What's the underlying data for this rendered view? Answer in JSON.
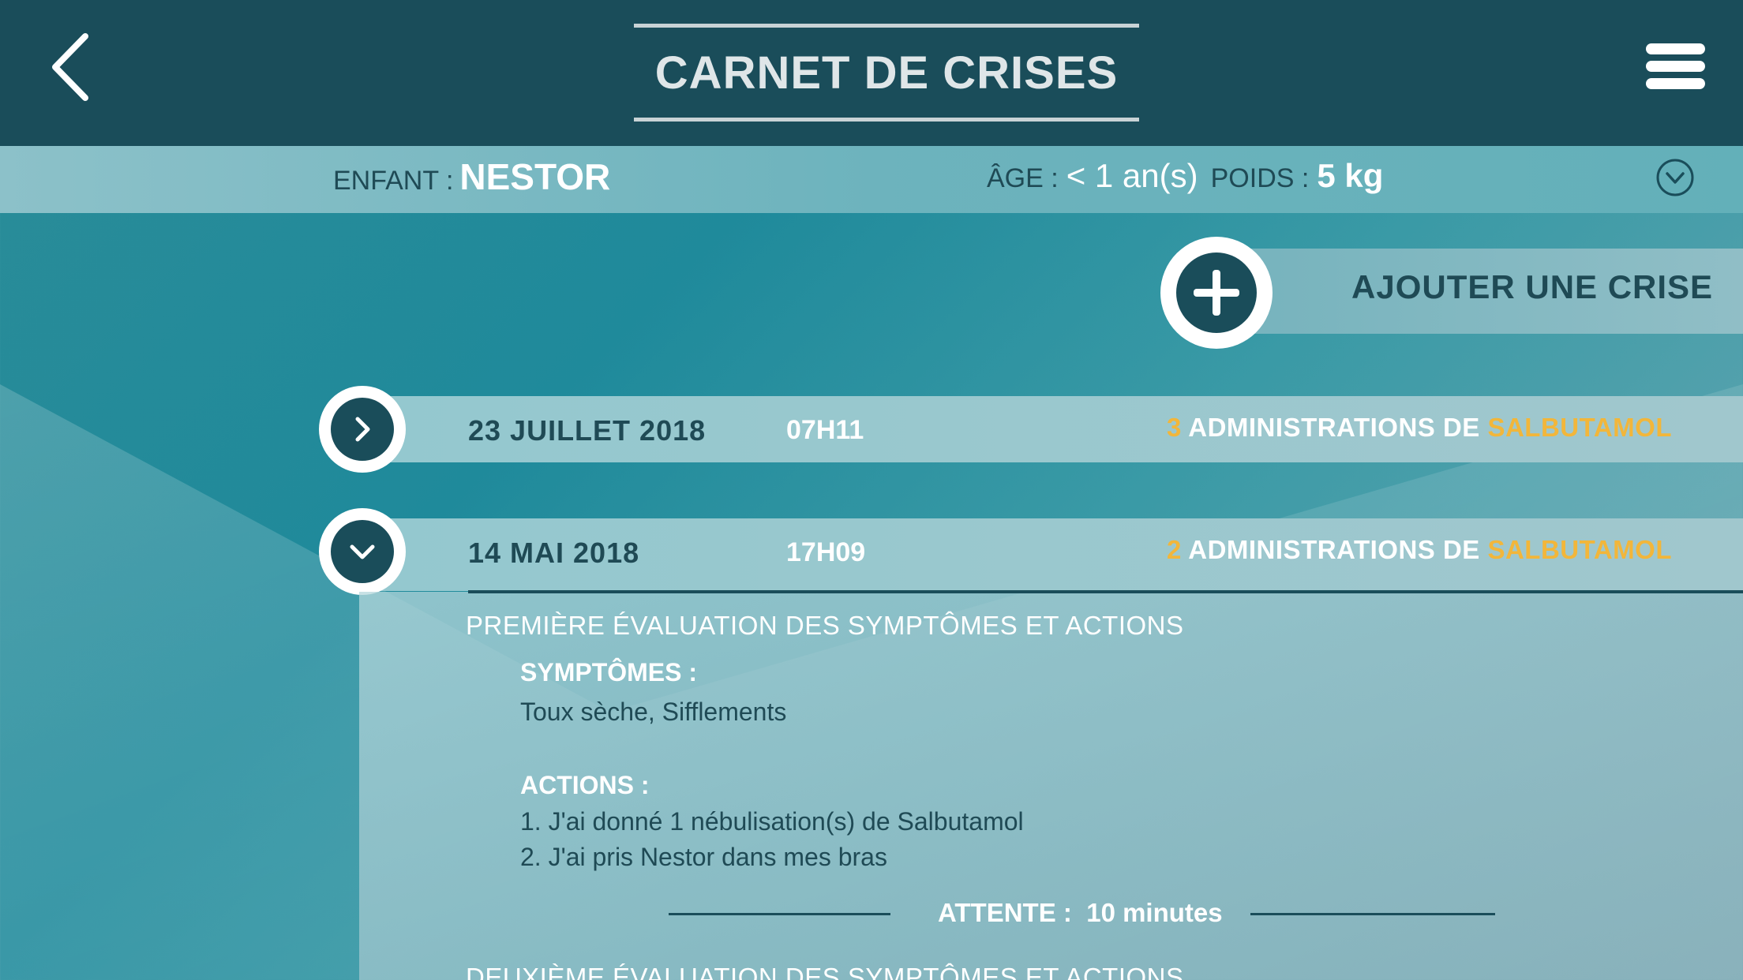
{
  "header": {
    "title": "CARNET DE CRISES"
  },
  "child": {
    "child_label": "ENFANT :",
    "child_name": "NESTOR",
    "age_label": "ÂGE :",
    "age_value": "< 1 an(s)",
    "weight_label": "POIDS :",
    "weight_value": "5 kg"
  },
  "add_crisis": {
    "label": "AJOUTER UNE CRISE"
  },
  "crises": [
    {
      "date": "23 JUILLET 2018",
      "time": "07H11",
      "count": "3",
      "admin_text": " ADMINISTRATIONS DE ",
      "drug": "SALBUTAMOL",
      "expanded": false
    },
    {
      "date": "14 MAI 2018",
      "time": "17H09",
      "count": "2",
      "admin_text": " ADMINISTRATIONS DE ",
      "drug": "SALBUTAMOL",
      "expanded": true
    }
  ],
  "detail": {
    "first_eval_title": "PREMIÈRE ÉVALUATION DES SYMPTÔMES ET ACTIONS",
    "symptoms_label": "SYMPTÔMES :",
    "symptoms_value": "Toux sèche, Sifflements",
    "actions_label": "ACTIONS :",
    "actions": [
      "1. J'ai donné 1 nébulisation(s) de Salbutamol",
      "2. J'ai pris Nestor dans mes bras"
    ],
    "wait_label": "ATTENTE :",
    "wait_value": "10 minutes",
    "second_eval_title": "DEUXIÈME ÉVALUATION DES SYMPTÔMES ET ACTIONS"
  },
  "colors": {
    "header_bg": "#1a4d5a",
    "accent_gold": "#f2b63a",
    "text_dark": "#1f4a55"
  },
  "icons": {
    "back": "chevron-left-icon",
    "menu": "hamburger-menu-icon",
    "dropdown": "chevron-down-circle-icon",
    "add": "plus-circle-icon",
    "row_collapsed": "chevron-right-icon",
    "row_expanded": "chevron-down-icon"
  }
}
